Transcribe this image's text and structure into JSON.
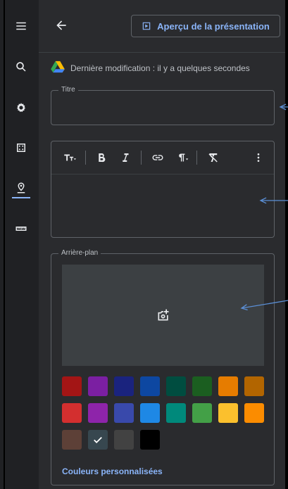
{
  "header": {
    "back_label": "",
    "preview_label": "Aperçu de la présentation"
  },
  "status": {
    "last_modified": "Dernière modification : il y a quelques secondes"
  },
  "title_field": {
    "label": "Titre",
    "value": ""
  },
  "background": {
    "label": "Arrière-plan",
    "custom_colors_label": "Couleurs personnalisées",
    "selected_index": 17,
    "swatches": [
      "#a31515",
      "#7b1fa2",
      "#1a237e",
      "#0d47a1",
      "#004d40",
      "#1b5e20",
      "#e67c00",
      "#b26500",
      "#d32f2f",
      "#8e24aa",
      "#3949ab",
      "#1e88e5",
      "#00897b",
      "#43a047",
      "#fbc02d",
      "#fb8c00",
      "#5d4037",
      "#37474f",
      "#424242",
      "#000000"
    ]
  },
  "theme": {
    "accent": "#8ab4f8",
    "annotation_arrow": "#5b8fd6"
  }
}
